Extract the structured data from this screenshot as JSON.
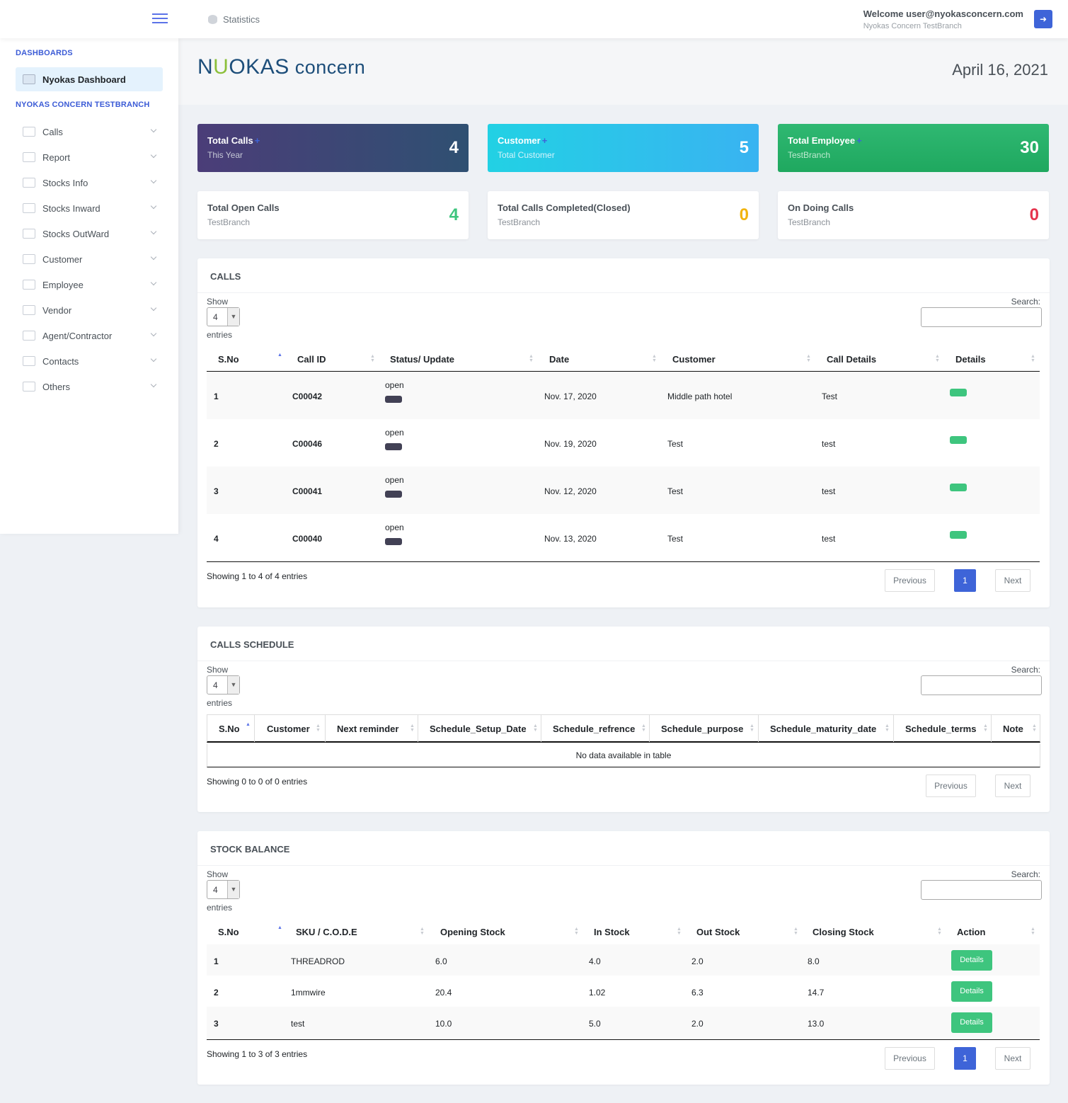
{
  "topbar": {
    "breadcrumb": "Statistics",
    "welcome": "Welcome user@nyokasconcern.com",
    "branch": "Nyokas Concern TestBranch"
  },
  "sidebar": {
    "dashboards_title": "DASHBOARDS",
    "active_item": "Nyokas Dashboard",
    "branch_title": "NYOKAS CONCERN TESTBRANCH",
    "items": [
      {
        "label": "Calls",
        "icon": "calendar-icon"
      },
      {
        "label": "Report",
        "icon": "calendar-icon"
      },
      {
        "label": "Stocks Info",
        "icon": "box-icon"
      },
      {
        "label": "Stocks Inward",
        "icon": "box-icon"
      },
      {
        "label": "Stocks OutWard",
        "icon": "box-icon"
      },
      {
        "label": "Customer",
        "icon": "car-icon"
      },
      {
        "label": "Employee",
        "icon": "car-icon"
      },
      {
        "label": "Vendor",
        "icon": "box-icon"
      },
      {
        "label": "Agent/Contractor",
        "icon": "box-icon"
      },
      {
        "label": "Contacts",
        "icon": "users-icon"
      },
      {
        "label": "Others",
        "icon": "users-icon"
      }
    ]
  },
  "header": {
    "logo_n": "N",
    "logo_u": "U",
    "logo_okas": "OKAS",
    "logo_concern": "concern",
    "date": "April 16, 2021"
  },
  "cards": [
    {
      "title": "Total Calls",
      "sub": "This Year",
      "value": "4",
      "plus": "+"
    },
    {
      "title": "Customer",
      "sub": "Total Customer",
      "value": "5",
      "plus": "+"
    },
    {
      "title": "Total Employee",
      "sub": "TestBranch",
      "value": "30",
      "plus": "+"
    },
    {
      "title": "Total Open Calls",
      "sub": "TestBranch",
      "value": "4"
    },
    {
      "title": "Total Calls Completed(Closed)",
      "sub": "TestBranch",
      "value": "0"
    },
    {
      "title": "On Doing Calls",
      "sub": "TestBranch",
      "value": "0"
    }
  ],
  "colors": {
    "open_value": "#3ec57e",
    "closed_value": "#f1b40f",
    "doing_value": "#e5344d",
    "accent": "#3e64d8"
  },
  "common": {
    "show": "Show",
    "entries": "entries",
    "search": "Search:",
    "page_size": "4",
    "previous": "Previous",
    "next": "Next",
    "page": "1"
  },
  "calls": {
    "title": "CALLS",
    "headers": [
      "S.No",
      "Call ID",
      "Status/ Update",
      "Date",
      "Customer",
      "Call Details",
      "Details"
    ],
    "rows": [
      {
        "sno": "1",
        "id": "C00042",
        "status": "open",
        "date": "Nov. 17, 2020",
        "customer": "Middle path hotel",
        "details": "Test"
      },
      {
        "sno": "2",
        "id": "C00046",
        "status": "open",
        "date": "Nov. 19, 2020",
        "customer": "Test",
        "details": "test"
      },
      {
        "sno": "3",
        "id": "C00041",
        "status": "open",
        "date": "Nov. 12, 2020",
        "customer": "Test",
        "details": "test"
      },
      {
        "sno": "4",
        "id": "C00040",
        "status": "open",
        "date": "Nov. 13, 2020",
        "customer": "Test",
        "details": "test"
      }
    ],
    "showing": "Showing 1 to 4 of 4 entries"
  },
  "schedule": {
    "title": "CALLS SCHEDULE",
    "headers": [
      "S.No",
      "Customer",
      "Next reminder",
      "Schedule_Setup_Date",
      "Schedule_refrence",
      "Schedule_purpose",
      "Schedule_maturity_date",
      "Schedule_terms",
      "Note"
    ],
    "empty": "No data available in table",
    "showing": "Showing 0 to 0 of 0 entries"
  },
  "stock": {
    "title": "STOCK BALANCE",
    "headers": [
      "S.No",
      "SKU / C.O.D.E",
      "Opening Stock",
      "In Stock",
      "Out Stock",
      "Closing Stock",
      "Action"
    ],
    "rows": [
      {
        "sno": "1",
        "sku": "THREADROD",
        "opening": "6.0",
        "in": "4.0",
        "out": "2.0",
        "closing": "8.0",
        "action": "Details"
      },
      {
        "sno": "2",
        "sku": "1mmwire",
        "opening": "20.4",
        "in": "1.02",
        "out": "6.3",
        "closing": "14.7",
        "action": "Details"
      },
      {
        "sno": "3",
        "sku": "test",
        "opening": "10.0",
        "in": "5.0",
        "out": "2.0",
        "closing": "13.0",
        "action": "Details"
      }
    ],
    "showing": "Showing 1 to 3 of 3 entries"
  }
}
